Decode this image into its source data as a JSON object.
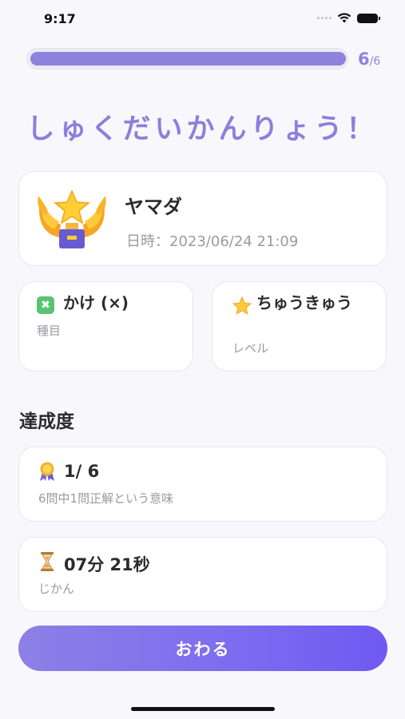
{
  "status_bar": {
    "time": "9:17",
    "icons": [
      "cellular-signal-icon",
      "wifi-icon",
      "battery-icon"
    ]
  },
  "progress": {
    "current": "6",
    "total": "/6",
    "fraction": 1.0,
    "color": "#8f82dc"
  },
  "title": "しゅくだいかんりょう！",
  "result_card": {
    "icon": "trophy-icon",
    "name": "ヤマダ",
    "datetime": "日時：2023/06/24 21:09"
  },
  "kind_card": {
    "icon": "multiply-icon",
    "icon_glyph": "✖",
    "value": "かけ (×)",
    "label": "種目"
  },
  "level_card": {
    "icon": "star-icon",
    "value": "ちゅうきゅう",
    "label": "レベル"
  },
  "achievement": {
    "heading": "達成度",
    "score": {
      "icon": "medal-icon",
      "value": "1/ 6",
      "label": "6問中1問正解という意味"
    },
    "time": {
      "icon": "hourglass-icon",
      "value": "07分 21秒",
      "label": "じかん"
    }
  },
  "finish_button": {
    "label": "おわる"
  },
  "colors": {
    "accent": "#8b80dc",
    "button_start": "#8d80e6",
    "button_end": "#6f59f2",
    "background": "#f8f8fc"
  }
}
